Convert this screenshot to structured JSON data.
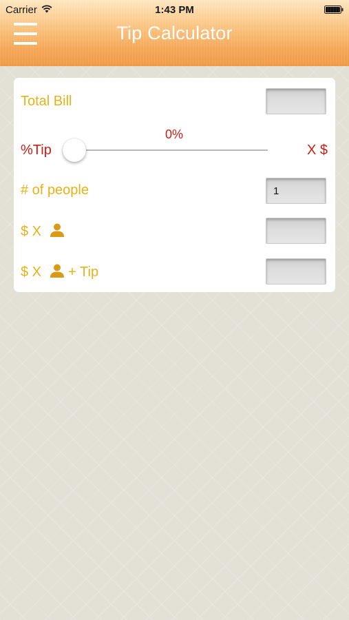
{
  "status_bar": {
    "carrier": "Carrier",
    "time": "1:43 PM",
    "wifi_icon": "wifi-icon",
    "battery_icon": "battery-icon"
  },
  "nav": {
    "title": "Tip Calculator",
    "menu_icon": "hamburger-menu-icon"
  },
  "form": {
    "total_bill": {
      "label": "Total Bill",
      "value": ""
    },
    "tip": {
      "label": "%Tip",
      "percent_text": "0%",
      "percent_value": 0,
      "multiplier_label": "X $"
    },
    "people": {
      "label": "# of people",
      "value": "1"
    },
    "per_person": {
      "label": "$ X",
      "icon": "user-icon",
      "value": ""
    },
    "per_person_tip": {
      "label_prefix": "$ X",
      "icon": "user-icon",
      "label_suffix": "+ Tip",
      "value": ""
    }
  },
  "colors": {
    "header_orange": "#f5a655",
    "label_yellow": "#e7b118",
    "accent_red": "#cc1c13",
    "icon_orange": "#d99a17"
  }
}
